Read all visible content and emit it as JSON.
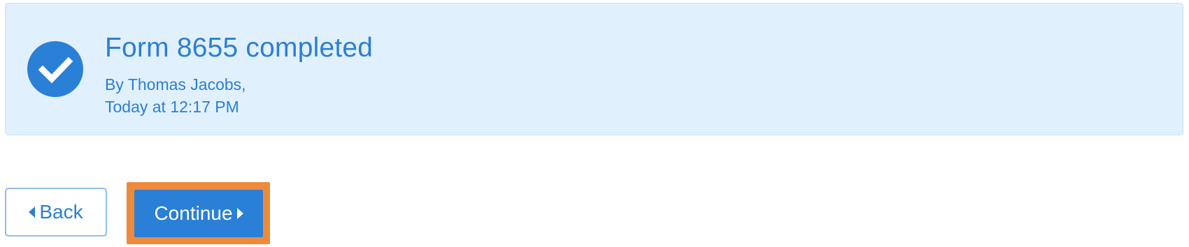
{
  "banner": {
    "title": "Form 8655 completed",
    "author_line": "By Thomas Jacobs,",
    "time_line": "Today at 12:17 PM",
    "icon": "check-circle-icon"
  },
  "actions": {
    "back_label": "Back",
    "continue_label": "Continue"
  },
  "colors": {
    "accent": "#2a7fd6",
    "banner_bg": "#e1f0fd",
    "focus_ring": "#ee8a3c"
  }
}
